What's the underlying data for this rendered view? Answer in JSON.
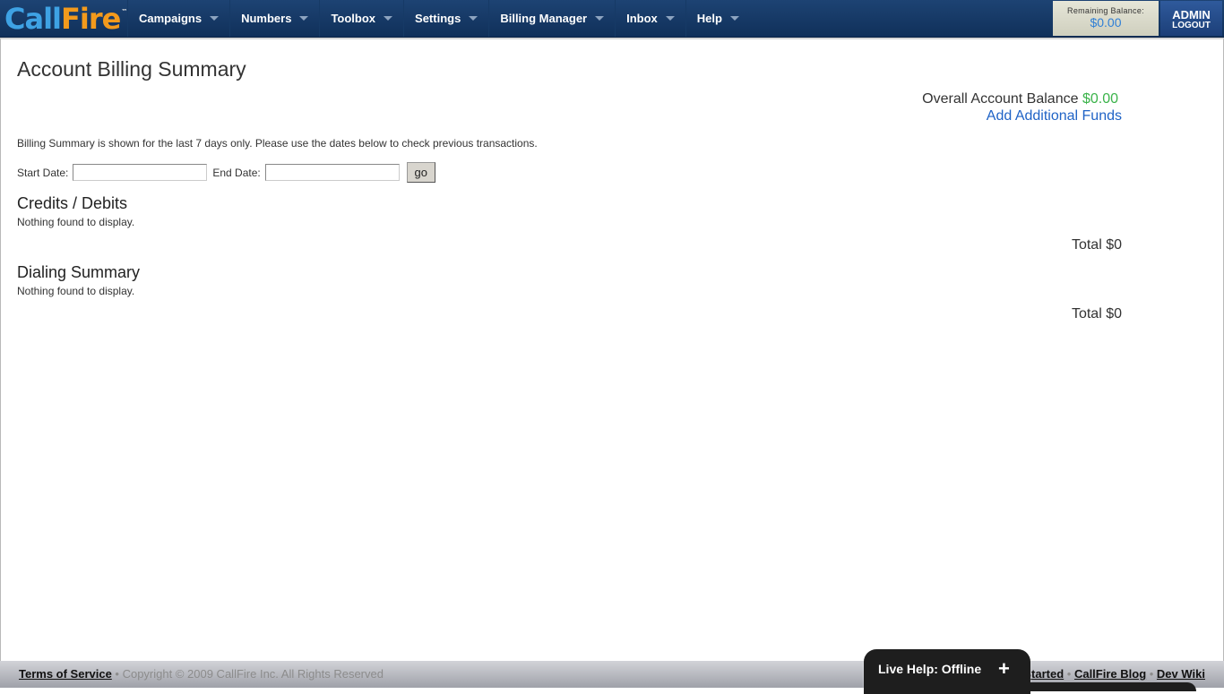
{
  "header": {
    "logo": {
      "part1": "Call",
      "part2": "Fire",
      "tm": "™"
    },
    "nav": [
      {
        "label": "Campaigns"
      },
      {
        "label": "Numbers"
      },
      {
        "label": "Toolbox"
      },
      {
        "label": "Settings"
      },
      {
        "label": "Billing Manager"
      },
      {
        "label": "Inbox"
      },
      {
        "label": "Help"
      }
    ],
    "balance": {
      "label": "Remaining Balance:",
      "value": "$0.00"
    },
    "user": {
      "name": "ADMIN",
      "logout": "LOGOUT"
    }
  },
  "main": {
    "title": "Account Billing Summary",
    "overall_label": "Overall Account Balance",
    "overall_value": "$0.00",
    "add_funds": "Add Additional Funds",
    "notice": "Billing Summary is shown for the last 7 days only. Please use the dates below to check previous transactions.",
    "start_label": "Start Date:",
    "start_value": "",
    "end_label": "End Date:",
    "end_value": "",
    "go_label": "go",
    "sections": [
      {
        "title": "Credits / Debits",
        "empty": "Nothing found to display.",
        "total": "Total $0"
      },
      {
        "title": "Dialing Summary",
        "empty": "Nothing found to display.",
        "total": "Total $0"
      }
    ]
  },
  "footer": {
    "terms": "Terms of Service",
    "copyright": " • Copyright © 2009 CallFire Inc. All Rights Reserved",
    "links": [
      "Getting Started",
      "CallFire Blog",
      "Dev Wiki"
    ],
    "separator": " • "
  },
  "live_help": {
    "label": "Live Help: Offline",
    "expand_icon": "+"
  },
  "colors": {
    "nav_bg": "#1d4373",
    "balance_value": "#2f7fd6",
    "positive_amount": "#3bb34a",
    "link": "#1f63c6"
  }
}
